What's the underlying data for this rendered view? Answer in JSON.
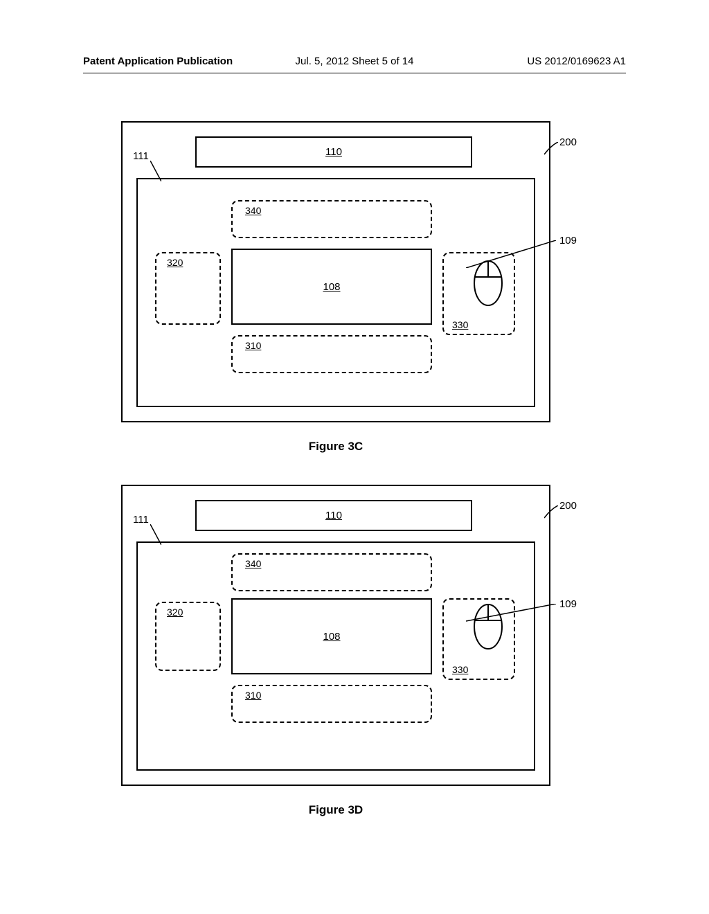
{
  "header": {
    "left": "Patent Application Publication",
    "center": "Jul. 5, 2012   Sheet 5 of 14",
    "right": "US 2012/0169623 A1"
  },
  "fig3c": {
    "ref110": "110",
    "ref111": "111",
    "ref200": "200",
    "ref109": "109",
    "ref340": "340",
    "ref320": "320",
    "ref108": "108",
    "ref330": "330",
    "ref310": "310",
    "caption": "Figure 3C"
  },
  "fig3d": {
    "ref110": "110",
    "ref111": "111",
    "ref200": "200",
    "ref109": "109",
    "ref340": "340",
    "ref320": "320",
    "ref108": "108",
    "ref330": "330",
    "ref310": "310",
    "caption": "Figure 3D"
  }
}
